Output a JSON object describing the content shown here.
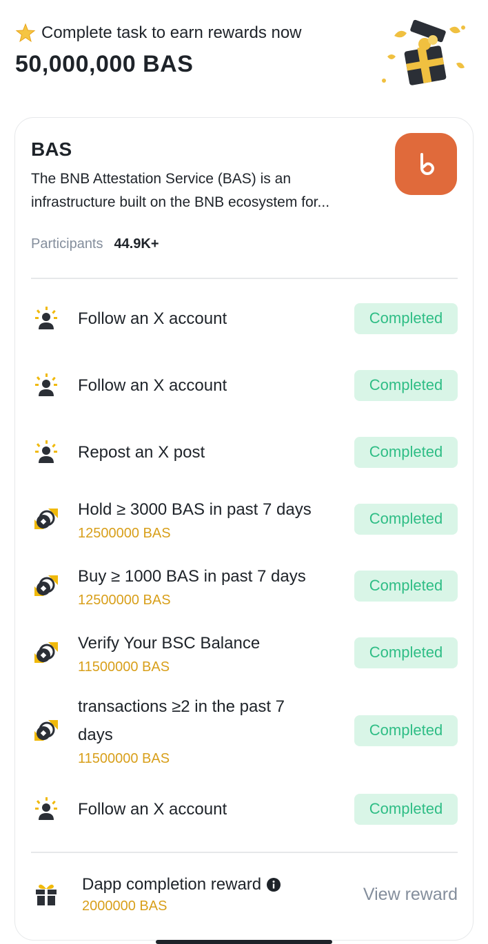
{
  "header": {
    "subtitle": "Complete task to earn rewards now",
    "amount": "50,000,000 BAS",
    "star_icon": "star-icon",
    "art_icon": "gift-box-icon"
  },
  "project": {
    "name": "BAS",
    "description_line1": "The BNB Attestation Service (BAS) is an",
    "description_line2": "infrastructure built on the BNB ecosystem for...",
    "participants_label": "Participants",
    "participants_value": "44.9K+",
    "logo_color": "#e06a3b",
    "logo_icon": "bas-logo-icon"
  },
  "colors": {
    "badge_bg": "#d9f5e7",
    "badge_text": "#2ebd85",
    "reward_text": "#d89f1a",
    "muted_text": "#848e9c"
  },
  "tasks": [
    {
      "title": "Follow an X account",
      "reward": "",
      "status": "Completed",
      "icon": "social-follow-icon"
    },
    {
      "title": "Follow an X account",
      "reward": "",
      "status": "Completed",
      "icon": "social-follow-icon"
    },
    {
      "title": "Repost an X post",
      "reward": "",
      "status": "Completed",
      "icon": "social-follow-icon"
    },
    {
      "title": "Hold ≥ 3000 BAS in past 7 days",
      "reward": "12500000 BAS",
      "status": "Completed",
      "icon": "onchain-token-icon"
    },
    {
      "title": "Buy ≥ 1000 BAS in past 7 days",
      "reward": "12500000 BAS",
      "status": "Completed",
      "icon": "onchain-token-icon"
    },
    {
      "title": "Verify Your BSC Balance",
      "reward": "11500000 BAS",
      "status": "Completed",
      "icon": "onchain-token-icon"
    },
    {
      "title_line1": "transactions ≥2 in the past 7",
      "title_line2": "days",
      "reward": "11500000 BAS",
      "status": "Completed",
      "icon": "onchain-token-icon"
    },
    {
      "title": "Follow an X account",
      "reward": "",
      "status": "Completed",
      "icon": "social-follow-icon"
    }
  ],
  "final": {
    "title": "Dapp completion reward",
    "reward": "2000000 BAS",
    "action": "View reward",
    "gift_icon": "gift-icon",
    "info_icon": "info-icon"
  }
}
